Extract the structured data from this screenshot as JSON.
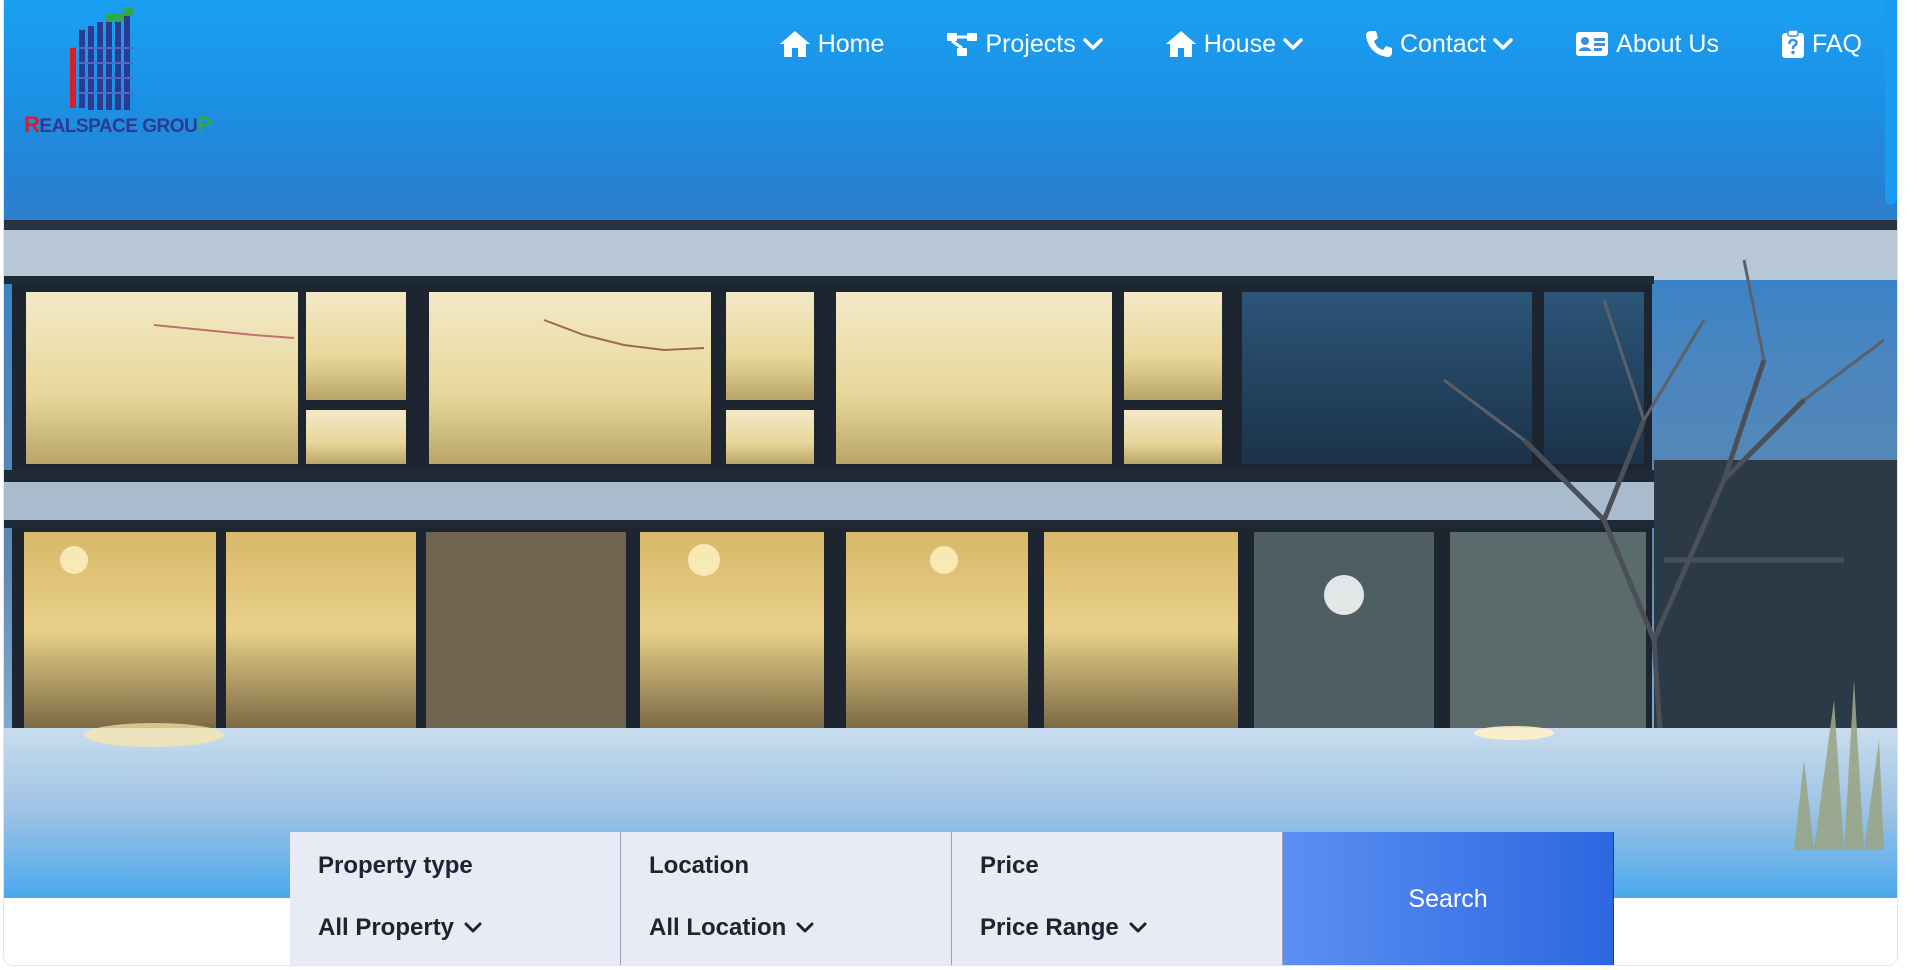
{
  "brand": {
    "name": "REALSPACE GROUP",
    "first_letter": "R",
    "middle": "EALSPACE GROU",
    "last_letter": "P"
  },
  "nav": {
    "items": [
      {
        "label": "Home",
        "icon": "home-icon",
        "dropdown": false
      },
      {
        "label": "Projects",
        "icon": "sitemap-icon",
        "dropdown": true
      },
      {
        "label": "House",
        "icon": "home-icon",
        "dropdown": true
      },
      {
        "label": "Contact",
        "icon": "phone-icon",
        "dropdown": true
      },
      {
        "label": "About Us",
        "icon": "id-card-icon",
        "dropdown": false
      },
      {
        "label": "FAQ",
        "icon": "clipboard-question-icon",
        "dropdown": false
      }
    ]
  },
  "search": {
    "fields": [
      {
        "label": "Property type",
        "value": "All Property"
      },
      {
        "label": "Location",
        "value": "All Location"
      },
      {
        "label": "Price",
        "value": "Price Range"
      }
    ],
    "button_label": "Search"
  },
  "colors": {
    "accent": "#2d67e0",
    "field_bg": "#e8ebf5",
    "logo_red": "#d81e2b",
    "logo_blue": "#2c3a8f",
    "logo_green": "#2fa84f"
  }
}
